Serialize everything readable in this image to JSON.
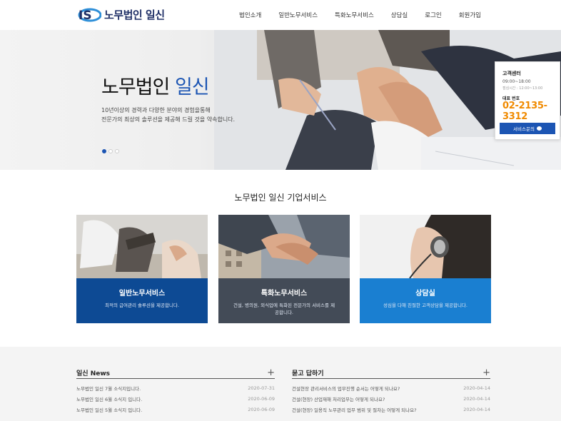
{
  "header": {
    "logo_mark": "IS",
    "logo_text": "노무법인 일신",
    "nav": [
      "법인소개",
      "일반노무서비스",
      "특화노무서비스",
      "상담실",
      "로그인",
      "회원가입"
    ]
  },
  "hero": {
    "title_main": "노무법인 ",
    "title_accent": "일신",
    "desc_line1": "10년이상의 경력과 다양한 분야의 경험을통해",
    "desc_line2": "전문가의 최상의 솔루션을 제공해 드릴 것을 약속합니다.",
    "slide_count": 3,
    "active_slide": 1
  },
  "customer_center": {
    "title": "고객센터",
    "hours": "09:00~18:00",
    "lunch": "점심시간 : 12:00~13:00",
    "phone_label": "대표 번호",
    "phone": "02-2135-3312",
    "button_label": "서비스문의"
  },
  "services": {
    "title": "노무법인 일신 기업서비스",
    "cards": [
      {
        "title": "일반노무서비스",
        "desc": "최적의 급여관리 솔루션을 제공합니다.",
        "color": "#0d4a94"
      },
      {
        "title": "특화노무서비스",
        "desc": "건설, 병의원, 외식업에 특화된 전문가의 서비스를 제공합니다.",
        "color": "#434b57"
      },
      {
        "title": "상담실",
        "desc": "성심을 다해 친절한 고객상담을 제공합니다.",
        "color": "#1a7fd1"
      }
    ]
  },
  "news": {
    "title": "일신 News",
    "items": [
      {
        "text": "노무법인 일신 7월 소식지입니다.",
        "date": "2020-07-31"
      },
      {
        "text": "노무법인 일신 6월 소식지 입니다.",
        "date": "2020-06-09"
      },
      {
        "text": "노무법인 일신 5월 소식지 입니다.",
        "date": "2020-06-09"
      }
    ]
  },
  "qna": {
    "title": "묻고 답하기",
    "items": [
      {
        "text": "건설현장 관리서비스의 업무진행 순서는 어떻게 되나요?",
        "date": "2020-04-14"
      },
      {
        "text": "건설(현장) 산업재해 처리업무는 어떻게 되나요?",
        "date": "2020-04-14"
      },
      {
        "text": "건설(현장) 일용직 노무관리 업무 범위 및 절차는 어떻게 되나요?",
        "date": "2020-04-14"
      }
    ]
  },
  "colors": {
    "brand_blue": "#1c55b3",
    "phone_orange": "#f08a00"
  }
}
